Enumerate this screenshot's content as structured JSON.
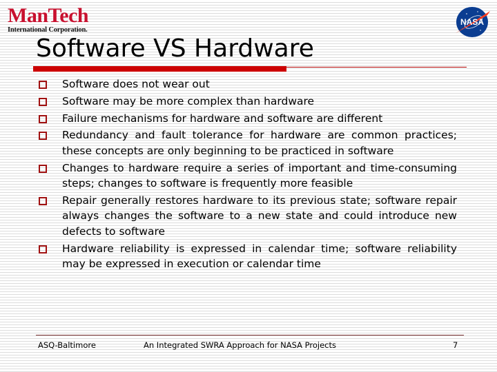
{
  "logos": {
    "company_name": "ManTech",
    "company_subtitle": "International Corporation.",
    "agency_logo_text": "NASA",
    "brand_color": "#c8102e",
    "nasa_blue": "#0b3d91"
  },
  "slide": {
    "title": "Software VS Hardware",
    "accent_color": "#cc0000",
    "bullets": [
      "Software does not wear out",
      "Software may be more complex than hardware",
      "Failure mechanisms for hardware and software are different",
      "Redundancy and fault tolerance for hardware are common practices; these concepts are only beginning to be practiced in software",
      "Changes to hardware require a series of important and time-consuming steps; changes to software is frequently more feasible",
      "Repair generally restores hardware to its previous state; software repair always changes the software to a new state and could introduce new defects to software",
      "Hardware reliability is expressed in calendar time; software reliability may be expressed in execution or calendar time"
    ]
  },
  "footer": {
    "left": "ASQ-Baltimore",
    "center": "An Integrated SWRA Approach for NASA Projects",
    "page_number": "7"
  }
}
